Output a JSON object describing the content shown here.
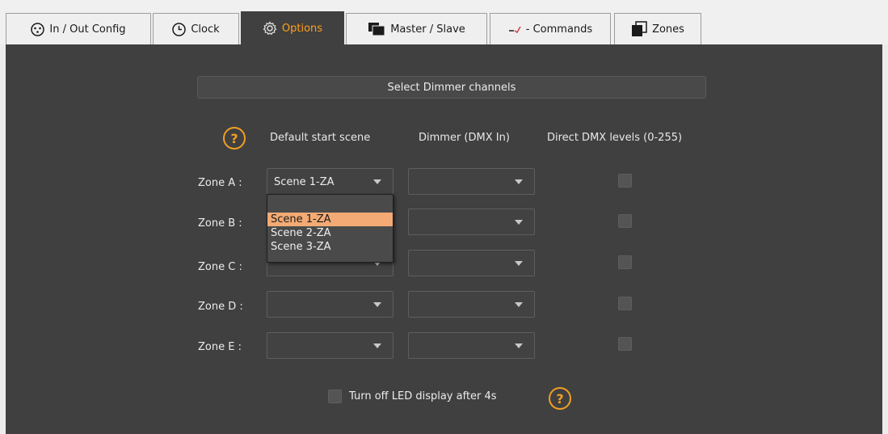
{
  "tabs": [
    {
      "label": "In / Out Config",
      "icon": "xlr-connector-icon"
    },
    {
      "label": "Clock",
      "icon": "clock-icon"
    },
    {
      "label": "Options",
      "icon": "gear-icon",
      "active": true
    },
    {
      "label": "Master / Slave",
      "icon": "master-slave-icon"
    },
    {
      "label": "- Commands",
      "icon": "commands-icon"
    },
    {
      "label": "Zones",
      "icon": "zones-icon"
    }
  ],
  "select_dimmer_label": "Select Dimmer channels",
  "columns": {
    "help": "?",
    "default_start_scene": "Default start scene",
    "dimmer": "Dimmer (DMX In)",
    "direct_dmx": "Direct DMX levels (0-255)"
  },
  "zones": [
    {
      "label": "Zone A :",
      "scene": "Scene 1-ZA",
      "dimmer": "",
      "direct_dmx": false
    },
    {
      "label": "Zone B :",
      "scene": "",
      "dimmer": "",
      "direct_dmx": false
    },
    {
      "label": "Zone C :",
      "scene": "",
      "dimmer": "",
      "direct_dmx": false
    },
    {
      "label": "Zone D :",
      "scene": "",
      "dimmer": "",
      "direct_dmx": false
    },
    {
      "label": "Zone E :",
      "scene": "",
      "dimmer": "",
      "direct_dmx": false
    }
  ],
  "scene_dropdown": {
    "open": true,
    "options": [
      "",
      "Scene 1-ZA",
      "Scene 2-ZA",
      "Scene 3-ZA"
    ],
    "highlighted": "Scene 1-ZA"
  },
  "led_option": {
    "label": "Turn off LED display after 4s",
    "checked": false,
    "help": "?"
  },
  "colors": {
    "accent": "#f0a024",
    "panel": "#404040",
    "highlight": "#f3aa74"
  }
}
